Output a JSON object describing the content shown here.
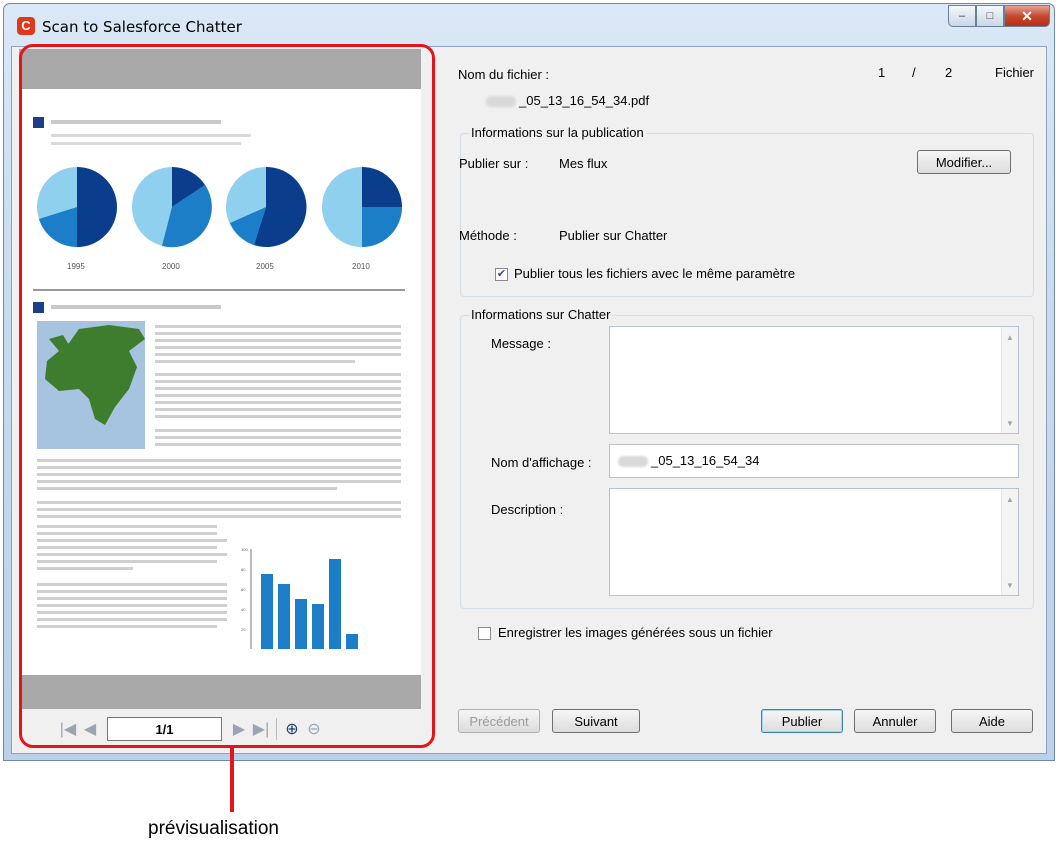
{
  "window": {
    "title": "Scan to Salesforce Chatter",
    "minimize": "–",
    "maximize": "□",
    "close": "✕"
  },
  "preview": {
    "callout_label": "prévisualisation",
    "page_indicator": "1/1",
    "chart_years": [
      "1995",
      "2000",
      "2005",
      "2010"
    ],
    "bar_values": [
      75,
      65,
      50,
      45,
      90,
      15
    ],
    "axis_ticks": [
      "100",
      "80",
      "60",
      "40",
      "20"
    ]
  },
  "file": {
    "name_label": "Nom du fichier :",
    "counter_current": "1",
    "counter_sep": "/",
    "counter_total": "2",
    "counter_unit": "Fichier",
    "filename": "_05_13_16_54_34.pdf"
  },
  "publication": {
    "group_title": "Informations sur la publication",
    "publish_on_label": "Publier sur :",
    "publish_on_value": "Mes flux",
    "modify_button": "Modifier...",
    "method_label": "Méthode :",
    "method_value": "Publier sur Chatter",
    "same_settings_checkbox": "Publier tous les fichiers avec le même paramètre"
  },
  "chatter": {
    "group_title": "Informations sur Chatter",
    "message_label": "Message :",
    "display_name_label": "Nom d'affichage :",
    "display_name_value": "_05_13_16_54_34",
    "description_label": "Description :"
  },
  "save_images_checkbox": "Enregistrer les images générées sous un fichier",
  "buttons": {
    "previous": "Précédent",
    "next": "Suivant",
    "publish": "Publier",
    "cancel": "Annuler",
    "help": "Aide"
  }
}
